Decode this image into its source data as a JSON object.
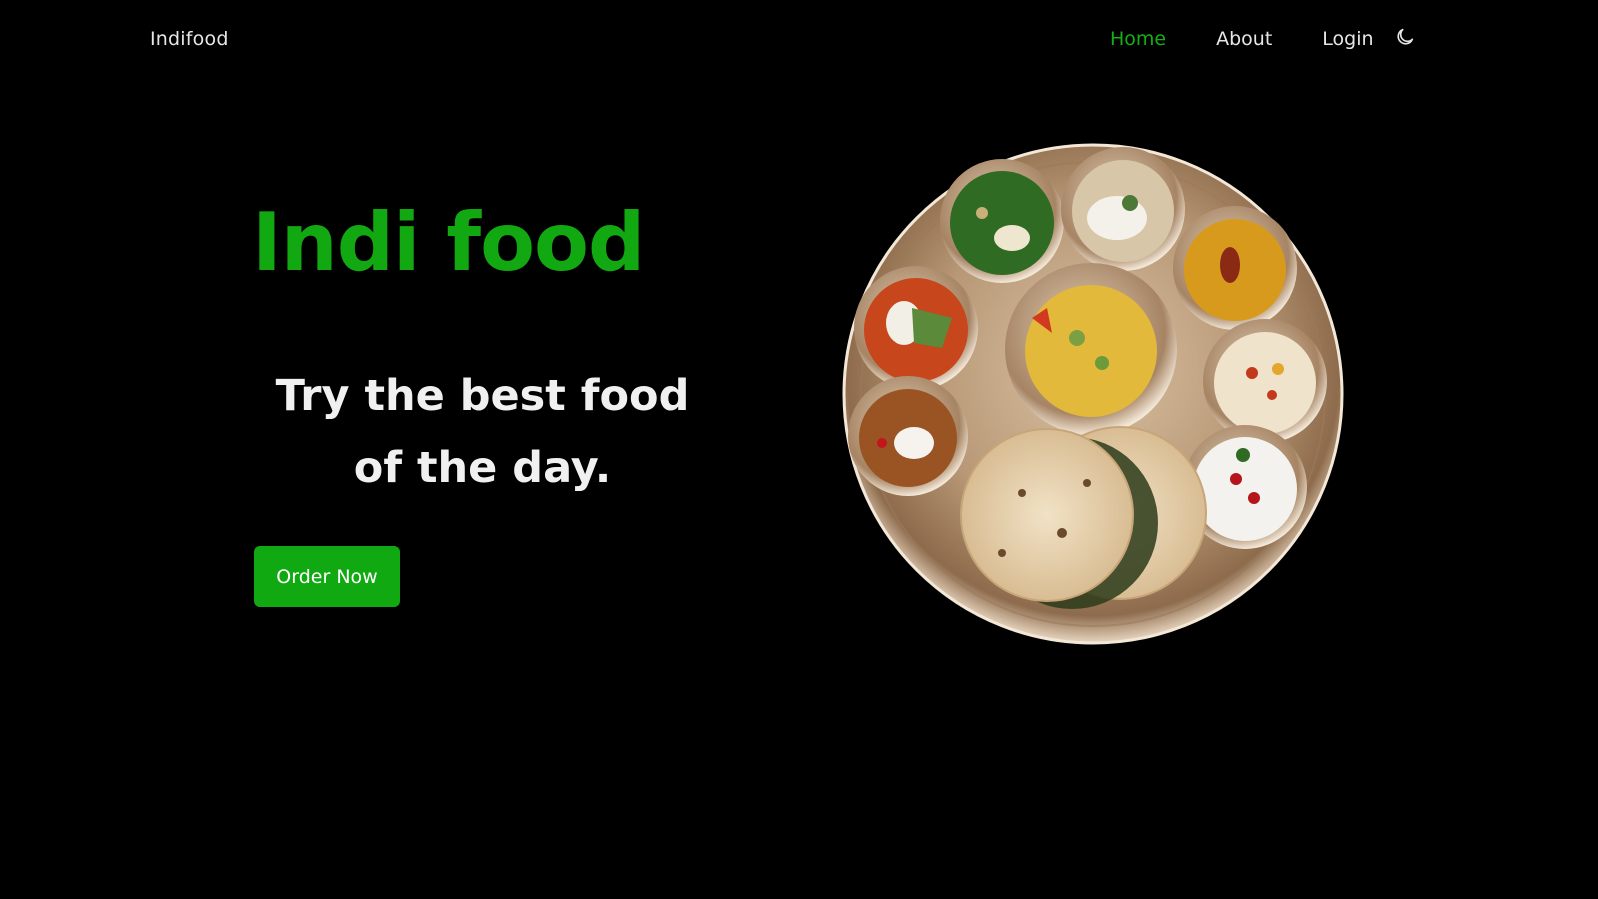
{
  "header": {
    "brand": "Indifood",
    "nav": [
      {
        "label": "Home",
        "active": true
      },
      {
        "label": "About",
        "active": false
      },
      {
        "label": "Login",
        "active": false
      }
    ],
    "theme_toggle_icon": "moon-icon"
  },
  "hero": {
    "title": "Indi food",
    "subtitle": "Try the best food of the day.",
    "cta_label": "Order Now",
    "image_subject": "thali-plate-image"
  },
  "colors": {
    "background": "#000000",
    "accent": "#12a812",
    "text": "#eaeaea"
  }
}
